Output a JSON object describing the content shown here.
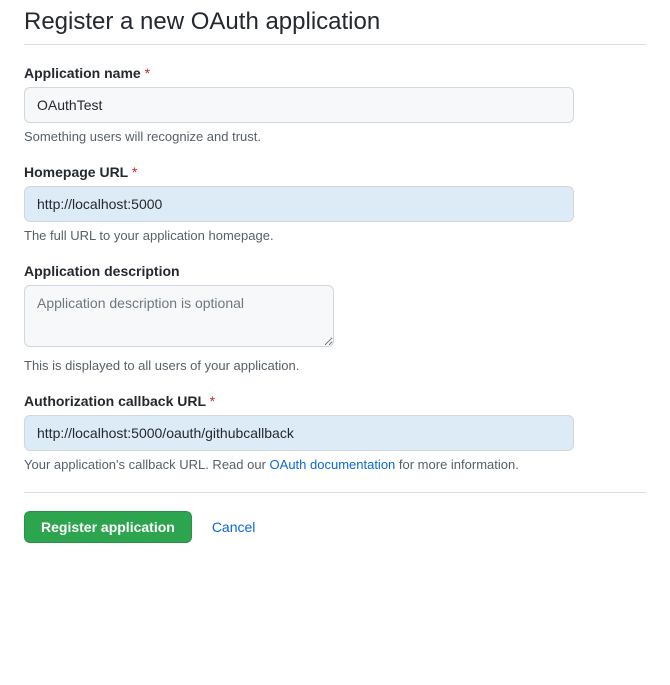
{
  "page": {
    "title": "Register a new OAuth application"
  },
  "fields": {
    "appName": {
      "label": "Application name",
      "required": "*",
      "value": "OAuthTest",
      "help": "Something users will recognize and trust."
    },
    "homepageUrl": {
      "label": "Homepage URL",
      "required": "*",
      "value": "http://localhost:5000",
      "help": "The full URL to your application homepage."
    },
    "description": {
      "label": "Application description",
      "placeholder": "Application description is optional",
      "value": "",
      "help": "This is displayed to all users of your application."
    },
    "callbackUrl": {
      "label": "Authorization callback URL",
      "required": "*",
      "value": "http://localhost:5000/oauth/githubcallback",
      "helpPrefix": "Your application's callback URL. Read our ",
      "helpLink": "OAuth documentation",
      "helpSuffix": " for more information."
    }
  },
  "actions": {
    "submit": "Register application",
    "cancel": "Cancel"
  }
}
